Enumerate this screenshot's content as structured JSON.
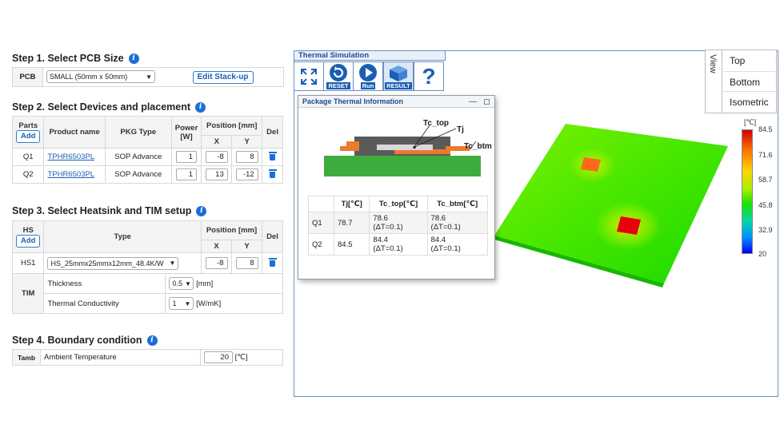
{
  "step1": {
    "title": "Step 1. Select PCB Size",
    "pcb_label": "PCB",
    "pcb_size": "SMALL (50mm x 50mm)",
    "edit_button": "Edit Stack-up"
  },
  "step2": {
    "title": "Step 2. Select Devices and placement",
    "headers": {
      "parts": "Parts",
      "add": "Add",
      "product": "Product name",
      "pkg": "PKG Type",
      "power": "Power [W]",
      "position": "Position [mm]",
      "x": "X",
      "y": "Y",
      "del": "Del"
    },
    "rows": [
      {
        "part": "Q1",
        "product": "TPHR6503PL",
        "pkg": "SOP Advance",
        "power": "1",
        "x": "-8",
        "y": "8"
      },
      {
        "part": "Q2",
        "product": "TPHR6503PL",
        "pkg": "SOP Advance",
        "power": "1",
        "x": "13",
        "y": "-12"
      }
    ]
  },
  "step3": {
    "title": "Step 3. Select Heatsink and TIM setup",
    "headers": {
      "hs": "HS",
      "add": "Add",
      "type": "Type",
      "position": "Position [mm]",
      "x": "X",
      "y": "Y",
      "del": "Del"
    },
    "hs_row": {
      "id": "HS1",
      "type": "HS_25mmx25mmx12mm_48.4K/W",
      "x": "-8",
      "y": "8"
    },
    "tim_label": "TIM",
    "thickness_label": "Thickness",
    "thickness_value": "0.5",
    "thickness_unit": "[mm]",
    "conductivity_label": "Thermal Conductivity",
    "conductivity_value": "1",
    "conductivity_unit": "[W/mK]"
  },
  "step4": {
    "title": "Step 4. Boundary condition",
    "tamb_label": "Tamb",
    "ambient_label": "Ambient Temperature",
    "ambient_value": "20",
    "ambient_unit": "[℃]"
  },
  "simulation": {
    "title": "Thermal Simulation",
    "reset_label": "RESET",
    "run_label": "Run",
    "result_label": "RESULT",
    "help_label": "?"
  },
  "view": {
    "tab_label": "View",
    "options": [
      "Top",
      "Bottom",
      "Isometric"
    ]
  },
  "package_info": {
    "title": "Package Thermal Information",
    "diagram_labels": {
      "tc_top": "Tc_top",
      "tj": "Tj",
      "tc_btm": "Tc_btm"
    },
    "headers": [
      "Tj[℃]",
      "Tc_top[℃]",
      "Tc_btm[℃]"
    ],
    "rows": [
      {
        "part": "Q1",
        "tj": "78.7",
        "tc_top": "78.6",
        "tc_top_dt": "(ΔT=0.1)",
        "tc_btm": "78.6",
        "tc_btm_dt": "(ΔT=0.1)"
      },
      {
        "part": "Q2",
        "tj": "84.5",
        "tc_top": "84.4",
        "tc_top_dt": "(ΔT=0.1)",
        "tc_btm": "84.4",
        "tc_btm_dt": "(ΔT=0.1)"
      }
    ]
  },
  "legend": {
    "unit": "[℃]",
    "ticks": [
      "84.5",
      "71.6",
      "58.7",
      "45.8",
      "32.9",
      "20"
    ]
  }
}
